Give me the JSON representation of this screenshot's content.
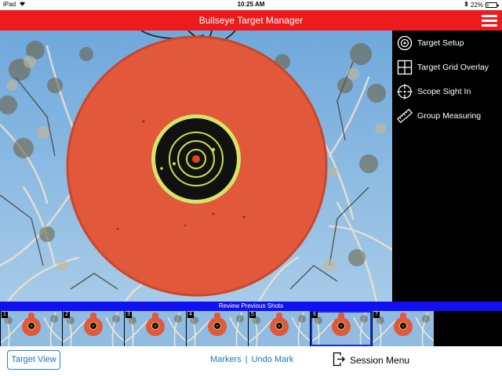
{
  "status_bar": {
    "device": "iPad",
    "time": "10:25 AM",
    "battery": "22%",
    "battery_level": 0.22
  },
  "header": {
    "title": "Bullseye Target Manager"
  },
  "side_menu": [
    {
      "label": "Target Setup",
      "icon": "target-setup-icon"
    },
    {
      "label": "Target Grid Overlay",
      "icon": "grid-overlay-icon"
    },
    {
      "label": "Scope Sight In",
      "icon": "crosshair-icon"
    },
    {
      "label": "Group Measuring",
      "icon": "ruler-icon"
    }
  ],
  "shots": {
    "title": "Review Previous Shots",
    "items": [
      {
        "number": "1"
      },
      {
        "number": "2"
      },
      {
        "number": "3"
      },
      {
        "number": "4"
      },
      {
        "number": "5"
      },
      {
        "number": "6",
        "selected": true
      },
      {
        "number": "7"
      }
    ]
  },
  "toolbar": {
    "target_view": "Target View",
    "markers": "Markers",
    "separator": "|",
    "undo_mark": "Undo Mark",
    "session_menu": "Session Menu"
  },
  "colors": {
    "header": "#ec1c1c",
    "strip_header": "#1010f0",
    "accent": "#1a73c9",
    "target": "#e2583a"
  }
}
